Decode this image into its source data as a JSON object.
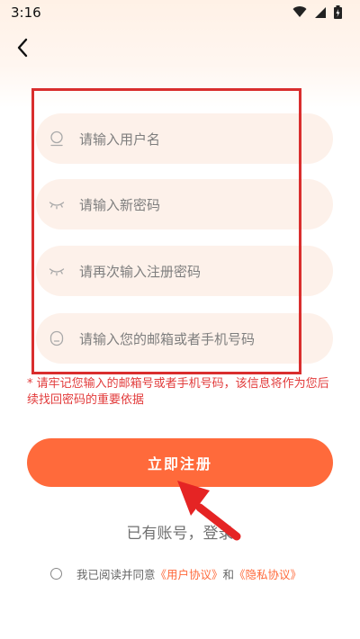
{
  "status": {
    "time": "3:16"
  },
  "form": {
    "username_placeholder": "请输入用户名",
    "password_placeholder": "请输入新密码",
    "confirm_placeholder": "请再次输入注册密码",
    "contact_placeholder": "请输入您的邮箱或者手机号码"
  },
  "notice": "* 请牢记您输入的邮箱号或者手机号码，该信息将作为您后续找回密码的重要依据",
  "register_button": "立即注册",
  "login_link": "已有账号，登录",
  "agreement": {
    "prefix": "我已阅读并同意",
    "user_agreement": "《用户协议》",
    "and": "和",
    "privacy_policy": "《隐私协议》"
  },
  "colors": {
    "accent": "#ff6a3b",
    "field_bg": "#fdf1ea",
    "annotation": "#d92e2e"
  }
}
